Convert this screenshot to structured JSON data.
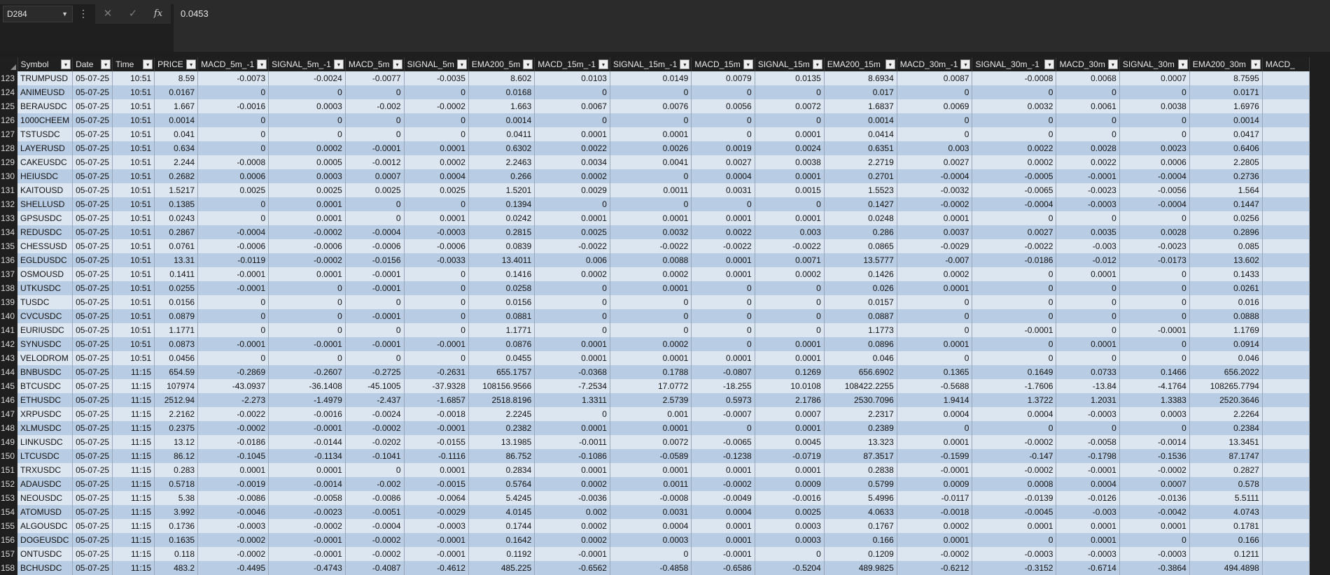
{
  "formula_bar": {
    "name_box": "D284",
    "name_box_dropdown_icon": "chevron-down-icon",
    "more_icon": "more-vertical-icon",
    "cancel_icon": "✕",
    "enter_icon": "✓",
    "function_icon": "fx",
    "formula_value": "0.0453"
  },
  "columns": [
    "Symbol",
    "Date",
    "Time",
    "PRICE",
    "MACD_5m_-1",
    "SIGNAL_5m_-1",
    "MACD_5m",
    "SIGNAL_5m",
    "EMA200_5m",
    "MACD_15m_-1",
    "SIGNAL_15m_-1",
    "MACD_15m",
    "SIGNAL_15m",
    "EMA200_15m",
    "MACD_30m_-1",
    "SIGNAL_30m_-1",
    "MACD_30m",
    "SIGNAL_30m",
    "EMA200_30m",
    "MACD_"
  ],
  "rows": [
    {
      "n": "123",
      "cells": [
        "TRUMPUSD",
        "05-07-25",
        "10:51",
        "8.59",
        "-0.0073",
        "-0.0024",
        "-0.0077",
        "-0.0035",
        "8.602",
        "0.0103",
        "0.0149",
        "0.0079",
        "0.0135",
        "8.6934",
        "0.0087",
        "-0.0008",
        "0.0068",
        "0.0007",
        "8.7595",
        ""
      ]
    },
    {
      "n": "124",
      "cells": [
        "ANIMEUSD",
        "05-07-25",
        "10:51",
        "0.0167",
        "0",
        "0",
        "0",
        "0",
        "0.0168",
        "0",
        "0",
        "0",
        "0",
        "0.017",
        "0",
        "0",
        "0",
        "0",
        "0.0171",
        ""
      ]
    },
    {
      "n": "125",
      "cells": [
        "BERAUSDC",
        "05-07-25",
        "10:51",
        "1.667",
        "-0.0016",
        "0.0003",
        "-0.002",
        "-0.0002",
        "1.663",
        "0.0067",
        "0.0076",
        "0.0056",
        "0.0072",
        "1.6837",
        "0.0069",
        "0.0032",
        "0.0061",
        "0.0038",
        "1.6976",
        ""
      ]
    },
    {
      "n": "126",
      "cells": [
        "1000CHEEM",
        "05-07-25",
        "10:51",
        "0.0014",
        "0",
        "0",
        "0",
        "0",
        "0.0014",
        "0",
        "0",
        "0",
        "0",
        "0.0014",
        "0",
        "0",
        "0",
        "0",
        "0.0014",
        ""
      ]
    },
    {
      "n": "127",
      "cells": [
        "TSTUSDC",
        "05-07-25",
        "10:51",
        "0.041",
        "0",
        "0",
        "0",
        "0",
        "0.0411",
        "0.0001",
        "0.0001",
        "0",
        "0.0001",
        "0.0414",
        "0",
        "0",
        "0",
        "0",
        "0.0417",
        ""
      ]
    },
    {
      "n": "128",
      "cells": [
        "LAYERUSD",
        "05-07-25",
        "10:51",
        "0.634",
        "0",
        "0.0002",
        "-0.0001",
        "0.0001",
        "0.6302",
        "0.0022",
        "0.0026",
        "0.0019",
        "0.0024",
        "0.6351",
        "0.003",
        "0.0022",
        "0.0028",
        "0.0023",
        "0.6406",
        ""
      ]
    },
    {
      "n": "129",
      "cells": [
        "CAKEUSDC",
        "05-07-25",
        "10:51",
        "2.244",
        "-0.0008",
        "0.0005",
        "-0.0012",
        "0.0002",
        "2.2463",
        "0.0034",
        "0.0041",
        "0.0027",
        "0.0038",
        "2.2719",
        "0.0027",
        "0.0002",
        "0.0022",
        "0.0006",
        "2.2805",
        ""
      ]
    },
    {
      "n": "130",
      "cells": [
        "HEIUSDC",
        "05-07-25",
        "10:51",
        "0.2682",
        "0.0006",
        "0.0003",
        "0.0007",
        "0.0004",
        "0.266",
        "0.0002",
        "0",
        "0.0004",
        "0.0001",
        "0.2701",
        "-0.0004",
        "-0.0005",
        "-0.0001",
        "-0.0004",
        "0.2736",
        ""
      ]
    },
    {
      "n": "131",
      "cells": [
        "KAITOUSD",
        "05-07-25",
        "10:51",
        "1.5217",
        "0.0025",
        "0.0025",
        "0.0025",
        "0.0025",
        "1.5201",
        "0.0029",
        "0.0011",
        "0.0031",
        "0.0015",
        "1.5523",
        "-0.0032",
        "-0.0065",
        "-0.0023",
        "-0.0056",
        "1.564",
        ""
      ]
    },
    {
      "n": "132",
      "cells": [
        "SHELLUSD",
        "05-07-25",
        "10:51",
        "0.1385",
        "0",
        "0.0001",
        "0",
        "0",
        "0.1394",
        "0",
        "0",
        "0",
        "0",
        "0.1427",
        "-0.0002",
        "-0.0004",
        "-0.0003",
        "-0.0004",
        "0.1447",
        ""
      ]
    },
    {
      "n": "133",
      "cells": [
        "GPSUSDC",
        "05-07-25",
        "10:51",
        "0.0243",
        "0",
        "0.0001",
        "0",
        "0.0001",
        "0.0242",
        "0.0001",
        "0.0001",
        "0.0001",
        "0.0001",
        "0.0248",
        "0.0001",
        "0",
        "0",
        "0",
        "0.0256",
        ""
      ]
    },
    {
      "n": "134",
      "cells": [
        "REDUSDC",
        "05-07-25",
        "10:51",
        "0.2867",
        "-0.0004",
        "-0.0002",
        "-0.0004",
        "-0.0003",
        "0.2815",
        "0.0025",
        "0.0032",
        "0.0022",
        "0.003",
        "0.286",
        "0.0037",
        "0.0027",
        "0.0035",
        "0.0028",
        "0.2896",
        ""
      ]
    },
    {
      "n": "135",
      "cells": [
        "CHESSUSD",
        "05-07-25",
        "10:51",
        "0.0761",
        "-0.0006",
        "-0.0006",
        "-0.0006",
        "-0.0006",
        "0.0839",
        "-0.0022",
        "-0.0022",
        "-0.0022",
        "-0.0022",
        "0.0865",
        "-0.0029",
        "-0.0022",
        "-0.003",
        "-0.0023",
        "0.085",
        ""
      ]
    },
    {
      "n": "136",
      "cells": [
        "EGLDUSDC",
        "05-07-25",
        "10:51",
        "13.31",
        "-0.0119",
        "-0.0002",
        "-0.0156",
        "-0.0033",
        "13.4011",
        "0.006",
        "0.0088",
        "0.0001",
        "0.0071",
        "13.5777",
        "-0.007",
        "-0.0186",
        "-0.012",
        "-0.0173",
        "13.602",
        ""
      ]
    },
    {
      "n": "137",
      "cells": [
        "OSMOUSD",
        "05-07-25",
        "10:51",
        "0.1411",
        "-0.0001",
        "0.0001",
        "-0.0001",
        "0",
        "0.1416",
        "0.0002",
        "0.0002",
        "0.0001",
        "0.0002",
        "0.1426",
        "0.0002",
        "0",
        "0.0001",
        "0",
        "0.1433",
        ""
      ]
    },
    {
      "n": "138",
      "cells": [
        "UTKUSDC",
        "05-07-25",
        "10:51",
        "0.0255",
        "-0.0001",
        "0",
        "-0.0001",
        "0",
        "0.0258",
        "0",
        "0.0001",
        "0",
        "0",
        "0.026",
        "0.0001",
        "0",
        "0",
        "0",
        "0.0261",
        ""
      ]
    },
    {
      "n": "139",
      "cells": [
        "TUSDC",
        "05-07-25",
        "10:51",
        "0.0156",
        "0",
        "0",
        "0",
        "0",
        "0.0156",
        "0",
        "0",
        "0",
        "0",
        "0.0157",
        "0",
        "0",
        "0",
        "0",
        "0.016",
        ""
      ]
    },
    {
      "n": "140",
      "cells": [
        "CVCUSDC",
        "05-07-25",
        "10:51",
        "0.0879",
        "0",
        "0",
        "-0.0001",
        "0",
        "0.0881",
        "0",
        "0",
        "0",
        "0",
        "0.0887",
        "0",
        "0",
        "0",
        "0",
        "0.0888",
        ""
      ]
    },
    {
      "n": "141",
      "cells": [
        "EURIUSDC",
        "05-07-25",
        "10:51",
        "1.1771",
        "0",
        "0",
        "0",
        "0",
        "1.1771",
        "0",
        "0",
        "0",
        "0",
        "1.1773",
        "0",
        "-0.0001",
        "0",
        "-0.0001",
        "1.1769",
        ""
      ]
    },
    {
      "n": "142",
      "cells": [
        "SYNUSDC",
        "05-07-25",
        "10:51",
        "0.0873",
        "-0.0001",
        "-0.0001",
        "-0.0001",
        "-0.0001",
        "0.0876",
        "0.0001",
        "0.0002",
        "0",
        "0.0001",
        "0.0896",
        "0.0001",
        "0",
        "0.0001",
        "0",
        "0.0914",
        ""
      ]
    },
    {
      "n": "143",
      "cells": [
        "VELODROM",
        "05-07-25",
        "10:51",
        "0.0456",
        "0",
        "0",
        "0",
        "0",
        "0.0455",
        "0.0001",
        "0.0001",
        "0.0001",
        "0.0001",
        "0.046",
        "0",
        "0",
        "0",
        "0",
        "0.046",
        ""
      ]
    },
    {
      "n": "144",
      "cells": [
        "BNBUSDC",
        "05-07-25",
        "11:15",
        "654.59",
        "-0.2869",
        "-0.2607",
        "-0.2725",
        "-0.2631",
        "655.1757",
        "-0.0368",
        "0.1788",
        "-0.0807",
        "0.1269",
        "656.6902",
        "0.1365",
        "0.1649",
        "0.0733",
        "0.1466",
        "656.2022",
        ""
      ]
    },
    {
      "n": "145",
      "cells": [
        "BTCUSDC",
        "05-07-25",
        "11:15",
        "107974",
        "-43.0937",
        "-36.1408",
        "-45.1005",
        "-37.9328",
        "108156.9566",
        "-7.2534",
        "17.0772",
        "-18.255",
        "10.0108",
        "108422.2255",
        "-0.5688",
        "-1.7606",
        "-13.84",
        "-4.1764",
        "108265.7794",
        ""
      ]
    },
    {
      "n": "146",
      "cells": [
        "ETHUSDC",
        "05-07-25",
        "11:15",
        "2512.94",
        "-2.273",
        "-1.4979",
        "-2.437",
        "-1.6857",
        "2518.8196",
        "1.3311",
        "2.5739",
        "0.5973",
        "2.1786",
        "2530.7096",
        "1.9414",
        "1.3722",
        "1.2031",
        "1.3383",
        "2520.3646",
        ""
      ]
    },
    {
      "n": "147",
      "cells": [
        "XRPUSDC",
        "05-07-25",
        "11:15",
        "2.2162",
        "-0.0022",
        "-0.0016",
        "-0.0024",
        "-0.0018",
        "2.2245",
        "0",
        "0.001",
        "-0.0007",
        "0.0007",
        "2.2317",
        "0.0004",
        "0.0004",
        "-0.0003",
        "0.0003",
        "2.2264",
        ""
      ]
    },
    {
      "n": "148",
      "cells": [
        "XLMUSDC",
        "05-07-25",
        "11:15",
        "0.2375",
        "-0.0002",
        "-0.0001",
        "-0.0002",
        "-0.0001",
        "0.2382",
        "0.0001",
        "0.0001",
        "0",
        "0.0001",
        "0.2389",
        "0",
        "0",
        "0",
        "0",
        "0.2384",
        ""
      ]
    },
    {
      "n": "149",
      "cells": [
        "LINKUSDC",
        "05-07-25",
        "11:15",
        "13.12",
        "-0.0186",
        "-0.0144",
        "-0.0202",
        "-0.0155",
        "13.1985",
        "-0.0011",
        "0.0072",
        "-0.0065",
        "0.0045",
        "13.323",
        "0.0001",
        "-0.0002",
        "-0.0058",
        "-0.0014",
        "13.3451",
        ""
      ]
    },
    {
      "n": "150",
      "cells": [
        "LTCUSDC",
        "05-07-25",
        "11:15",
        "86.12",
        "-0.1045",
        "-0.1134",
        "-0.1041",
        "-0.1116",
        "86.752",
        "-0.1086",
        "-0.0589",
        "-0.1238",
        "-0.0719",
        "87.3517",
        "-0.1599",
        "-0.147",
        "-0.1798",
        "-0.1536",
        "87.1747",
        ""
      ]
    },
    {
      "n": "151",
      "cells": [
        "TRXUSDC",
        "05-07-25",
        "11:15",
        "0.283",
        "0.0001",
        "0.0001",
        "0",
        "0.0001",
        "0.2834",
        "0.0001",
        "0.0001",
        "0.0001",
        "0.0001",
        "0.2838",
        "-0.0001",
        "-0.0002",
        "-0.0001",
        "-0.0002",
        "0.2827",
        ""
      ]
    },
    {
      "n": "152",
      "cells": [
        "ADAUSDC",
        "05-07-25",
        "11:15",
        "0.5718",
        "-0.0019",
        "-0.0014",
        "-0.002",
        "-0.0015",
        "0.5764",
        "0.0002",
        "0.0011",
        "-0.0002",
        "0.0009",
        "0.5799",
        "0.0009",
        "0.0008",
        "0.0004",
        "0.0007",
        "0.578",
        ""
      ]
    },
    {
      "n": "153",
      "cells": [
        "NEOUSDC",
        "05-07-25",
        "11:15",
        "5.38",
        "-0.0086",
        "-0.0058",
        "-0.0086",
        "-0.0064",
        "5.4245",
        "-0.0036",
        "-0.0008",
        "-0.0049",
        "-0.0016",
        "5.4996",
        "-0.0117",
        "-0.0139",
        "-0.0126",
        "-0.0136",
        "5.5111",
        ""
      ]
    },
    {
      "n": "154",
      "cells": [
        "ATOMUSD",
        "05-07-25",
        "11:15",
        "3.992",
        "-0.0046",
        "-0.0023",
        "-0.0051",
        "-0.0029",
        "4.0145",
        "0.002",
        "0.0031",
        "0.0004",
        "0.0025",
        "4.0633",
        "-0.0018",
        "-0.0045",
        "-0.003",
        "-0.0042",
        "4.0743",
        ""
      ]
    },
    {
      "n": "155",
      "cells": [
        "ALGOUSDC",
        "05-07-25",
        "11:15",
        "0.1736",
        "-0.0003",
        "-0.0002",
        "-0.0004",
        "-0.0003",
        "0.1744",
        "0.0002",
        "0.0004",
        "0.0001",
        "0.0003",
        "0.1767",
        "0.0002",
        "0.0001",
        "0.0001",
        "0.0001",
        "0.1781",
        ""
      ]
    },
    {
      "n": "156",
      "cells": [
        "DOGEUSDC",
        "05-07-25",
        "11:15",
        "0.1635",
        "-0.0002",
        "-0.0001",
        "-0.0002",
        "-0.0001",
        "0.1642",
        "0.0002",
        "0.0003",
        "0.0001",
        "0.0003",
        "0.166",
        "0.0001",
        "0",
        "0.0001",
        "0",
        "0.166",
        ""
      ]
    },
    {
      "n": "157",
      "cells": [
        "ONTUSDC",
        "05-07-25",
        "11:15",
        "0.118",
        "-0.0002",
        "-0.0001",
        "-0.0002",
        "-0.0001",
        "0.1192",
        "-0.0001",
        "0",
        "-0.0001",
        "0",
        "0.1209",
        "-0.0002",
        "-0.0003",
        "-0.0003",
        "-0.0003",
        "0.1211",
        ""
      ]
    },
    {
      "n": "158",
      "cells": [
        "BCHUSDC",
        "05-07-25",
        "11:15",
        "483.2",
        "-0.4495",
        "-0.4743",
        "-0.4087",
        "-0.4612",
        "485.225",
        "-0.6562",
        "-0.4858",
        "-0.6586",
        "-0.5204",
        "489.9825",
        "-0.6212",
        "-0.3152",
        "-0.6714",
        "-0.3864",
        "494.4898",
        ""
      ]
    }
  ]
}
